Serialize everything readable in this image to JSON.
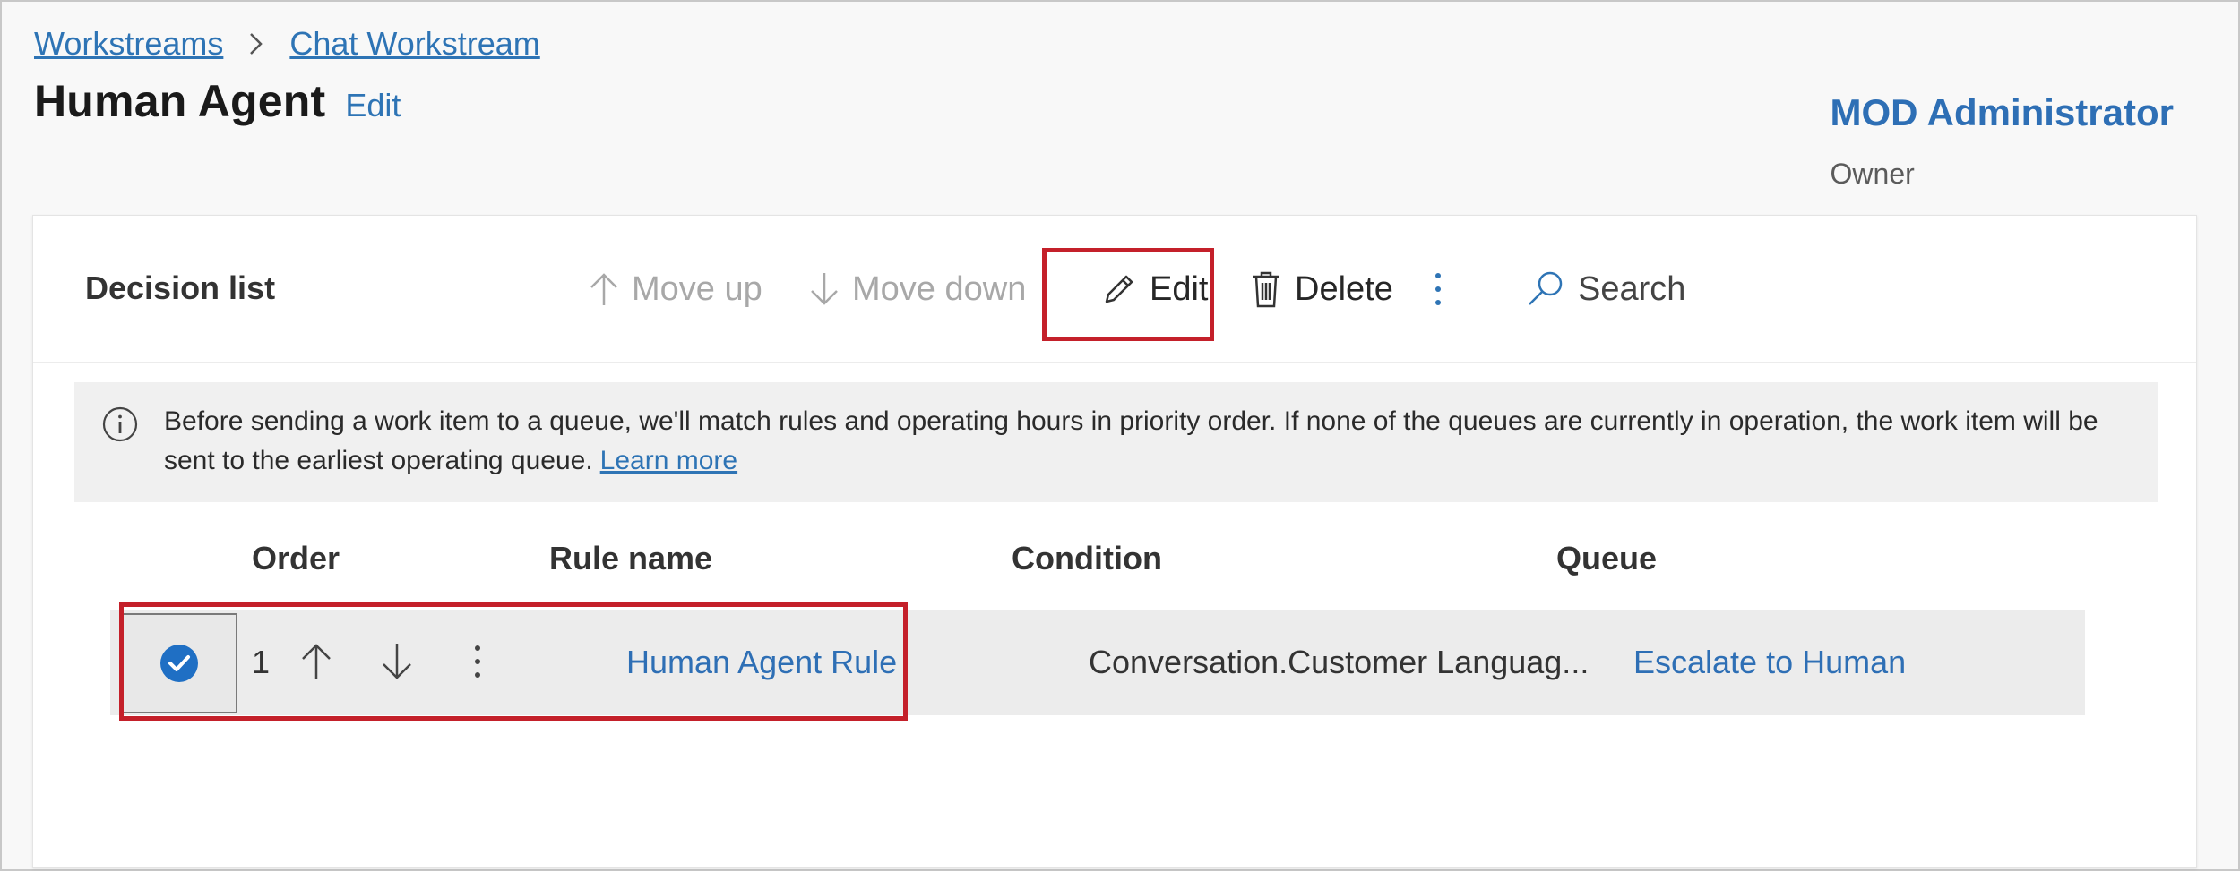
{
  "breadcrumb": {
    "items": [
      "Workstreams",
      "Chat Workstream"
    ]
  },
  "page": {
    "title": "Human Agent",
    "edit_label": "Edit"
  },
  "owner": {
    "name": "MOD Administrator",
    "role": "Owner"
  },
  "toolbar": {
    "title": "Decision list",
    "move_up": "Move up",
    "move_down": "Move down",
    "edit": "Edit",
    "delete": "Delete",
    "search": "Search"
  },
  "info": {
    "text": "Before sending a work item to a queue, we'll match rules and operating hours in priority order. If none of the queues are currently in operation, the work item will be sent to the earliest operating queue.",
    "learn_more": "Learn more"
  },
  "table": {
    "columns": [
      "Order",
      "Rule name",
      "Condition",
      "Queue"
    ],
    "rows": [
      {
        "order": "1",
        "rule_name": "Human Agent Rule",
        "condition": "Conversation.Customer Languag...",
        "queue": "Escalate to Human",
        "selected": true
      }
    ]
  },
  "colors": {
    "link": "#2e74b5",
    "highlight": "#c4202a",
    "check_fill": "#1f6fc4"
  }
}
